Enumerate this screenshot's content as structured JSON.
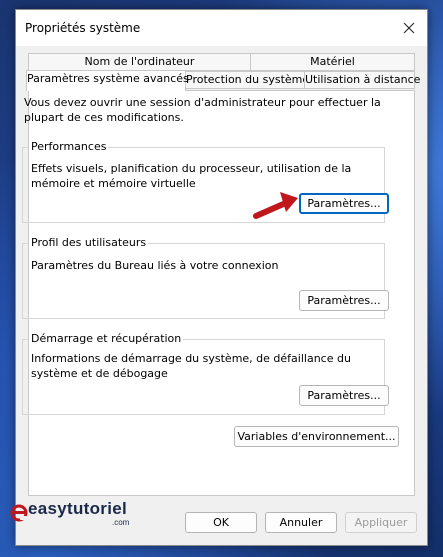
{
  "window": {
    "title": "Propriétés système"
  },
  "tabs_row1": [
    {
      "label": "Nom de l'ordinateur"
    },
    {
      "label": "Matériel"
    }
  ],
  "tabs_row2": [
    {
      "label": "Paramètres système avancés",
      "active": true
    },
    {
      "label": "Protection du système"
    },
    {
      "label": "Utilisation à distance"
    }
  ],
  "intro": "Vous devez ouvrir une session d'administrateur pour effectuer la plupart de ces modifications.",
  "groups": {
    "performance": {
      "title": "Performances",
      "description": "Effets visuels, planification du processeur, utilisation de la mémoire et mémoire virtuelle",
      "button": "Paramètres..."
    },
    "profiles": {
      "title": "Profil des utilisateurs",
      "description": "Paramètres du Bureau liés à votre connexion",
      "button": "Paramètres..."
    },
    "startup": {
      "title": "Démarrage et récupération",
      "description": "Informations de démarrage du système, de défaillance du système et de débogage",
      "button": "Paramètres..."
    }
  },
  "env_button": "Variables d'environnement...",
  "footer": {
    "ok": "OK",
    "cancel": "Annuler",
    "apply": "Appliquer"
  },
  "watermark": {
    "brand": "easytutoriel",
    "suffix": ".com"
  },
  "colors": {
    "accent": "#0067c0",
    "arrow": "#c0171c"
  }
}
